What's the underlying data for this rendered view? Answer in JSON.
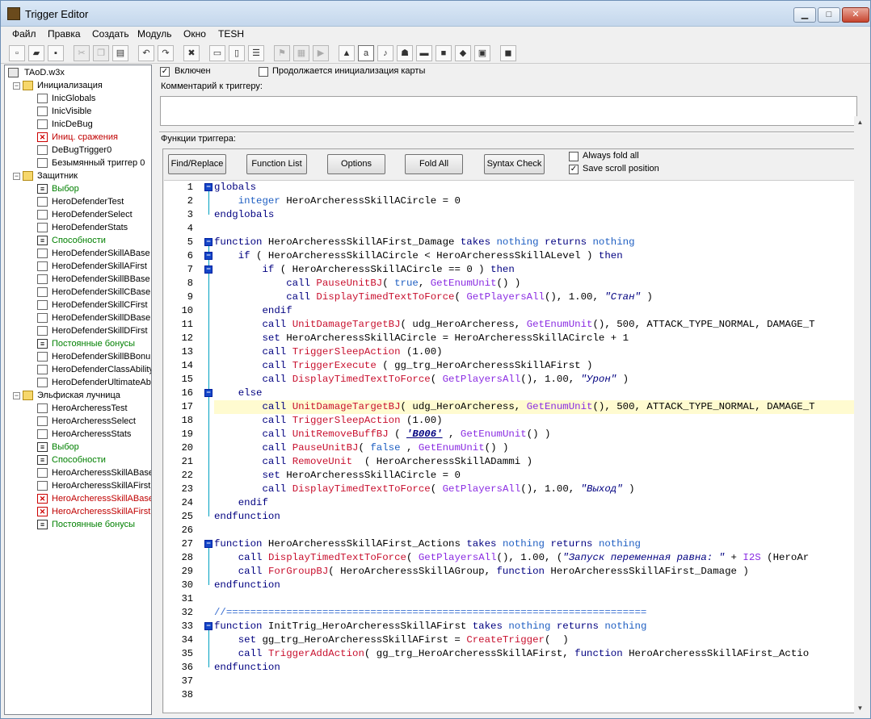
{
  "window": {
    "title": "Trigger Editor",
    "min": "▁",
    "max": "□",
    "close": "✕"
  },
  "menu": [
    "Файл",
    "Правка",
    "Создать",
    "Модуль",
    "Окно",
    "TESH"
  ],
  "tree": {
    "root": "TAoD.w3x",
    "items": [
      {
        "label": "Инициализация",
        "kind": "folder",
        "color": "#000000"
      },
      {
        "label": "InicGlobals",
        "kind": "trig",
        "color": "#000000"
      },
      {
        "label": "InicVisible",
        "kind": "trig",
        "color": "#000000"
      },
      {
        "label": "InicDeBug",
        "kind": "trig",
        "color": "#000000"
      },
      {
        "label": "Иниц. сражения",
        "kind": "trig-off",
        "color": "#c00000"
      },
      {
        "label": "DeBugTrigger0",
        "kind": "trig",
        "color": "#000000"
      },
      {
        "label": "Безымянный триггер 0",
        "kind": "trig",
        "color": "#000000"
      },
      {
        "label": "Защитник",
        "kind": "folder",
        "color": "#000000"
      },
      {
        "label": "Выбор",
        "kind": "var",
        "color": "#008000"
      },
      {
        "label": "HeroDefenderTest",
        "kind": "trig",
        "color": "#000000"
      },
      {
        "label": "HeroDefenderSelect",
        "kind": "trig",
        "color": "#000000"
      },
      {
        "label": "HeroDefenderStats",
        "kind": "trig",
        "color": "#000000"
      },
      {
        "label": "Способности",
        "kind": "var",
        "color": "#008000"
      },
      {
        "label": "HeroDefenderSkillABase",
        "kind": "trig",
        "color": "#000000"
      },
      {
        "label": "HeroDefenderSkillAFirst",
        "kind": "trig",
        "color": "#000000"
      },
      {
        "label": "HeroDefenderSkillBBase",
        "kind": "trig",
        "color": "#000000"
      },
      {
        "label": "HeroDefenderSkillCBase",
        "kind": "trig",
        "color": "#000000"
      },
      {
        "label": "HeroDefenderSkillCFirst",
        "kind": "trig",
        "color": "#000000"
      },
      {
        "label": "HeroDefenderSkillDBase",
        "kind": "trig",
        "color": "#000000"
      },
      {
        "label": "HeroDefenderSkillDFirst",
        "kind": "trig",
        "color": "#000000"
      },
      {
        "label": "Постоянные бонусы",
        "kind": "var",
        "color": "#008000"
      },
      {
        "label": "HeroDefenderSkillBBonu",
        "kind": "trig",
        "color": "#000000"
      },
      {
        "label": "HeroDefenderClassAbility",
        "kind": "trig",
        "color": "#000000"
      },
      {
        "label": "HeroDefenderUltimateAb",
        "kind": "trig",
        "color": "#000000"
      },
      {
        "label": "Эльфиская лучница",
        "kind": "folder",
        "color": "#000000"
      },
      {
        "label": "HeroArcheressTest",
        "kind": "trig",
        "color": "#000000"
      },
      {
        "label": "HeroArcheressSelect",
        "kind": "trig",
        "color": "#000000"
      },
      {
        "label": "HeroArcheressStats",
        "kind": "trig",
        "color": "#000000"
      },
      {
        "label": "Выбор",
        "kind": "var",
        "color": "#008000"
      },
      {
        "label": "Способности",
        "kind": "var",
        "color": "#008000"
      },
      {
        "label": "HeroArcheressSkillABase",
        "kind": "trig",
        "color": "#000000"
      },
      {
        "label": "HeroArcheressSkillAFirst",
        "kind": "trig",
        "color": "#000000"
      },
      {
        "label": "HeroArcheressSkillABase",
        "kind": "trig-off",
        "color": "#c00000"
      },
      {
        "label": "HeroArcheressSkillAFirstF",
        "kind": "trig-off",
        "color": "#c00000"
      },
      {
        "label": "Постоянные бонусы",
        "kind": "var",
        "color": "#008000"
      }
    ]
  },
  "options": {
    "enabled_label": "Включен",
    "continues_label": "Продолжается инициализация карты",
    "comment_label": "Комментарий к триггеру:",
    "functions_label": "Функции триггера:"
  },
  "editor_buttons": {
    "find_replace": "Find/Replace",
    "function_list": "Function List",
    "options": "Options",
    "fold_all": "Fold All",
    "syntax_check": "Syntax Check",
    "always_fold": "Always fold all",
    "save_scroll": "Save scroll position"
  },
  "code_lines": [
    "globals",
    "    integer HeroArcheressSkillACircle = 0",
    "endglobals",
    "",
    "function HeroArcheressSkillAFirst_Damage takes nothing returns nothing",
    "    if ( HeroArcheressSkillACircle < HeroArcheressSkillALevel ) then",
    "        if ( HeroArcheressSkillACircle == 0 ) then",
    "            call PauseUnitBJ( true, GetEnumUnit() )",
    "            call DisplayTimedTextToForce( GetPlayersAll(), 1.00, \"Стан\" )",
    "        endif",
    "        call UnitDamageTargetBJ( udg_HeroArcheress, GetEnumUnit(), 500, ATTACK_TYPE_NORMAL, DAMAGE_T",
    "        set HeroArcheressSkillACircle = HeroArcheressSkillACircle + 1",
    "        call TriggerSleepAction (1.00)",
    "        call TriggerExecute ( gg_trg_HeroArcheressSkillAFirst )",
    "        call DisplayTimedTextToForce( GetPlayersAll(), 1.00, \"Урон\" )",
    "    else",
    "        call UnitDamageTargetBJ( udg_HeroArcheress, GetEnumUnit(), 500, ATTACK_TYPE_NORMAL, DAMAGE_T",
    "        call TriggerSleepAction (1.00)",
    "        call UnitRemoveBuffBJ ( 'B006' , GetEnumUnit() )",
    "        call PauseUnitBJ( false , GetEnumUnit() )",
    "        call RemoveUnit  ( HeroArcheressSkillADammi )",
    "        set HeroArcheressSkillACircle = 0",
    "        call DisplayTimedTextToForce( GetPlayersAll(), 1.00, \"Выход\" )",
    "    endif",
    "endfunction",
    "",
    "function HeroArcheressSkillAFirst_Actions takes nothing returns nothing",
    "    call DisplayTimedTextToForce( GetPlayersAll(), 1.00, (\"Запуск переменная равна: \" + I2S (HeroAr",
    "    call ForGroupBJ( HeroArcheressSkillAGroup, function HeroArcheressSkillAFirst_Damage )",
    "endfunction",
    "",
    "//======================================================================",
    "function InitTrig_HeroArcheressSkillAFirst takes nothing returns nothing",
    "    set gg_trg_HeroArcheressSkillAFirst = CreateTrigger(  )",
    "    call TriggerAddAction( gg_trg_HeroArcheressSkillAFirst, function HeroArcheressSkillAFirst_Actio",
    "endfunction",
    "",
    ""
  ],
  "highlighted_line": 17
}
